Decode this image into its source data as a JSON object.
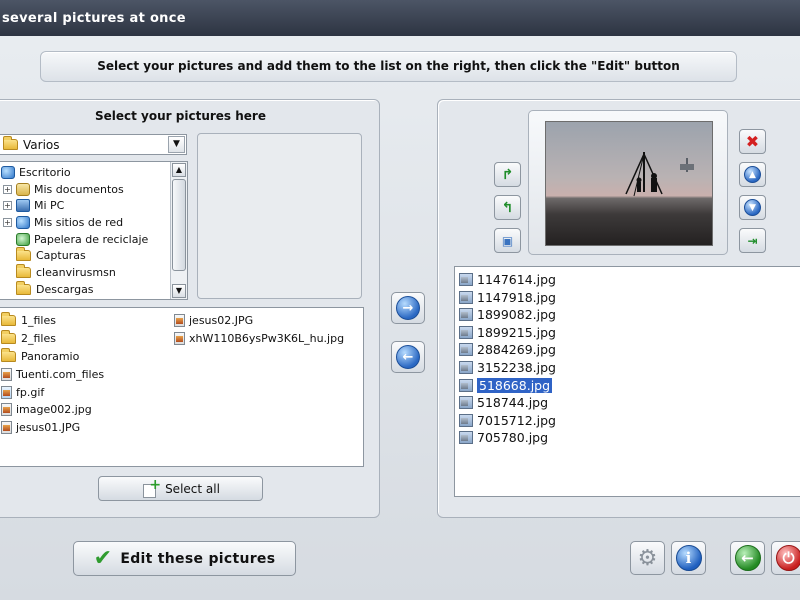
{
  "window": {
    "title": "several pictures at once"
  },
  "instructions": "Select your pictures and add them to the list on the right, then click the \"Edit\" button",
  "left_panel": {
    "heading": "Select your pictures here",
    "folder_combo": {
      "selected": "Varios"
    },
    "tree": [
      {
        "label": "Escritorio",
        "icon": "desktop-icon",
        "expander": ""
      },
      {
        "label": "Mis documentos",
        "icon": "documents-icon",
        "expander": "+"
      },
      {
        "label": "Mi PC",
        "icon": "computer-icon",
        "expander": "+"
      },
      {
        "label": "Mis sitios de red",
        "icon": "network-icon",
        "expander": "+"
      },
      {
        "label": "Papelera de reciclaje",
        "icon": "recycle-bin-icon",
        "expander": ""
      },
      {
        "label": "Capturas",
        "icon": "folder-icon",
        "expander": ""
      },
      {
        "label": "cleanvirusmsn",
        "icon": "folder-icon",
        "expander": ""
      },
      {
        "label": "Descargas",
        "icon": "folder-icon",
        "expander": ""
      }
    ],
    "files_col1": [
      "1_files",
      "2_files",
      "Panoramio",
      "Tuenti.com_files",
      "fp.gif",
      "image002.jpg",
      "jesus01.JPG"
    ],
    "files_col2": [
      "jesus02.JPG",
      "xhW110B6ysPw3K6L_hu.jpg"
    ],
    "select_all_label": "Select all"
  },
  "right_panel": {
    "images": [
      "1147614.jpg",
      "1147918.jpg",
      "1899082.jpg",
      "1899215.jpg",
      "2884269.jpg",
      "3152238.jpg",
      "518668.jpg",
      "518744.jpg",
      "7015712.jpg",
      "705780.jpg"
    ],
    "selected_image": "518668.jpg"
  },
  "buttons": {
    "edit_label": "Edit these pictures"
  },
  "colors": {
    "selection": "#2f63c6",
    "title_bar": "#3a4252"
  }
}
